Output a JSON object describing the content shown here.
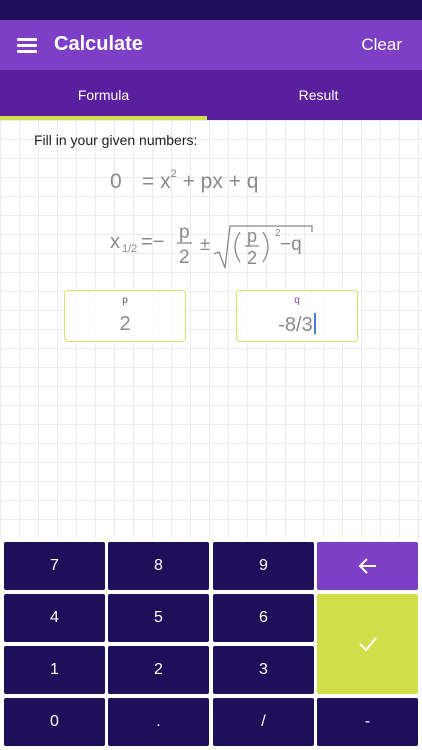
{
  "header": {
    "title": "Calculate",
    "clear_label": "Clear",
    "menu_icon": "hamburger-menu-icon"
  },
  "tabs": [
    {
      "label": "Formula",
      "active": true
    },
    {
      "label": "Result",
      "active": false
    }
  ],
  "formula": {
    "instruction": "Fill in your given numbers:",
    "equation_left": "0",
    "equation_right_pre": "= x",
    "equation_exponent": "2",
    "equation_right_post": " + px + q"
  },
  "inputs": {
    "p": {
      "label": "p",
      "value": "2"
    },
    "q": {
      "label": "q",
      "value": "-8/3"
    }
  },
  "keypad": {
    "keys": [
      "7",
      "8",
      "9",
      "4",
      "5",
      "6",
      "1",
      "2",
      "3",
      "0",
      ".",
      "/",
      "-"
    ],
    "backspace_icon": "backspace-arrow-icon",
    "confirm_icon": "checkmark-icon"
  },
  "colors": {
    "primary": "#7c3fc6",
    "tab_bar": "#5a1f9e",
    "dark": "#1e0f5a",
    "accent": "#cfe04a"
  }
}
